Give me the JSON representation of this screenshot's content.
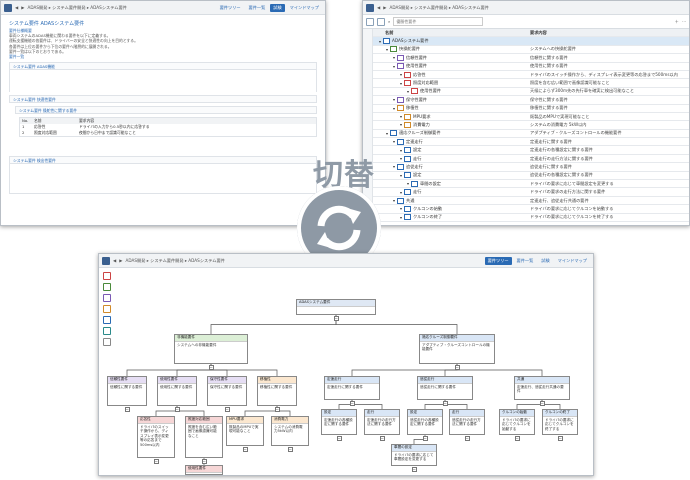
{
  "doc_window": {
    "breadcrumb": "ADAS開発 ▸ システム要件開発 ▸ ADASシステム要件",
    "tabs": [
      "要件ツリー",
      "要件一覧",
      "試験",
      "マインドマップ"
    ],
    "active_tab": "試験",
    "title": "システム要件 ADASシステム要件",
    "lines": [
      "要件仕様概要",
      "車両システムのADAS機能に関わる要件を以下に定義する。",
      "運転支援機能の各要件は、ドライバーの安全と快適性の向上を目的とする。",
      "各要件は上位の要件から下位の要件へ階層的に展開される。",
      "要件一覧は以下のとおりである。",
      "要件一覧"
    ],
    "sections": [
      "システム要件 ADAS機能",
      "システム要件 快適性要件",
      "システム要件 操舵性に関する要件",
      "システム要件 検出性要件"
    ],
    "table_header": [
      "No.",
      "名前",
      "要求内容"
    ],
    "table_rows": [
      [
        "1",
        "応答性",
        "ドライバの入力から0.5秒以内に応答する"
      ],
      [
        "2",
        "照度対応範囲",
        "夜間から日中まで認識可能なこと"
      ]
    ]
  },
  "tree_window": {
    "search_placeholder": "優勝性要件",
    "breadcrumb": "ADAS開発 ▸ システム要件開発 ▸ ADASシステム要件",
    "columns": [
      "名前",
      "要求内容"
    ],
    "rows": [
      {
        "name": "ADASシステム要件",
        "desc": "",
        "sel": true
      },
      {
        "name": "快操舵要件",
        "desc": "システムへの快操舵要件"
      },
      {
        "name": "信頼性要件",
        "desc": "信頼性に関する要件"
      },
      {
        "name": "使用性要件",
        "desc": "使用性に関する要件"
      },
      {
        "name": "応答性",
        "desc": "ドライバのスイッチ操作から、ディスプレイ表示変更等の応答まで500ms以内"
      },
      {
        "name": "照度対応範囲",
        "desc": "照度を含む広い範囲で画像認識可能なこと"
      },
      {
        "name": "使用性要件",
        "desc": "天候によらず300m先の先行車を確実に検出可能なこと"
      },
      {
        "name": "保守性要件",
        "desc": "保守性に関する要件"
      },
      {
        "name": "移植性",
        "desc": "移植性に関する要件"
      },
      {
        "name": "MPU要求",
        "desc": "既製品のMPUで実現可能なこと"
      },
      {
        "name": "消費電力",
        "desc": "システムの消費電力 5kW以内"
      },
      {
        "name": "適応クルーズ制御要件",
        "desc": "アダプティブ・クルーズコントロールの機能要件"
      },
      {
        "name": "定速走行",
        "desc": "定速走行に関する要件"
      },
      {
        "name": "設定",
        "desc": "定速走行の各種設定に関する要件"
      },
      {
        "name": "走行",
        "desc": "定速走行の走行方法に関する要件"
      },
      {
        "name": "追従走行",
        "desc": "追従走行に関する要件"
      },
      {
        "name": "設定",
        "desc": "追従走行の各種設定に関する要件"
      },
      {
        "name": "車間の設定",
        "desc": "ドライバの要求に応じて車間設定を変更する"
      },
      {
        "name": "走行",
        "desc": "ドライバの要求の走行方法に関する要件"
      },
      {
        "name": "共通",
        "desc": "定速走行、追従走行共通の要件"
      },
      {
        "name": "クルコンの始動",
        "desc": "ドライバの要求に応じてクルコンを始動する"
      },
      {
        "name": "クルコンの終了",
        "desc": "ドライバの要求に応じてクルコンを終了する"
      }
    ]
  },
  "switch_label": "切替",
  "map_window": {
    "breadcrumb": "ADAS開発 ▸ システム要件開発 ▸ ADASシステム要件",
    "tabs": [
      "要件ツリー",
      "要件一覧",
      "試験",
      "マインドマップ"
    ],
    "active_tab": "要件ツリー",
    "nodes": {
      "root": {
        "h": "ADASシステム要件",
        "t": ""
      },
      "n1": {
        "h": "非機能要件",
        "t": "システムへの非機能要件"
      },
      "n2": {
        "h": "適応クルーズ制御要件",
        "t": "アダプティブ・クルーズコントロールの機能要件"
      },
      "a1": {
        "h": "信頼性要件",
        "t": "信頼性に関する要件"
      },
      "a2": {
        "h": "使用性要件",
        "t": "使用性に関する要件"
      },
      "a3": {
        "h": "保守性要件",
        "t": "保守性に関する要件"
      },
      "a4": {
        "h": "移植性",
        "t": "移植性に関する要件"
      },
      "b1": {
        "h": "定速走行",
        "t": "定速走行に関する要件"
      },
      "b2": {
        "h": "追従走行",
        "t": "追従走行に関する要件"
      },
      "b3": {
        "h": "共通",
        "t": "定速走行、追従走行共通の要件"
      },
      "c1": {
        "h": "応答性",
        "t": "ドライバのスイッチ操作から、ディスプレイ表示変更等の応答まで500ms以内"
      },
      "c2": {
        "h": "照度対応範囲",
        "t": "照度を含む広い範囲で画像認識可能なこと"
      },
      "c3": {
        "h": "MPU要求",
        "t": "既製品のMPUで実現可能なこと"
      },
      "c4": {
        "h": "消費電力",
        "t": "システムの消費電力5kW以内"
      },
      "d1": {
        "h": "設定",
        "t": "定速走行の各種設定に関する要件"
      },
      "d2": {
        "h": "走行",
        "t": "定速走行の走行方法に関する要件"
      },
      "d3": {
        "h": "設定",
        "t": "追従走行の各種設定に関する要件"
      },
      "d4": {
        "h": "走行",
        "t": "追従走行の走行方法に関する要件"
      },
      "d5": {
        "h": "クルコンの始動",
        "t": "ドライバの要求に応じてクルコンを始動する"
      },
      "d6": {
        "h": "クルコンの終了",
        "t": "ドライバの要求に応じてクルコンを終了する"
      },
      "e1": {
        "h": "使用性要件",
        "t": "天候によらず300m先"
      },
      "e2": {
        "h": "車間の設定",
        "t": "ドライバの要求に応じて車間設定を変更する"
      }
    }
  }
}
